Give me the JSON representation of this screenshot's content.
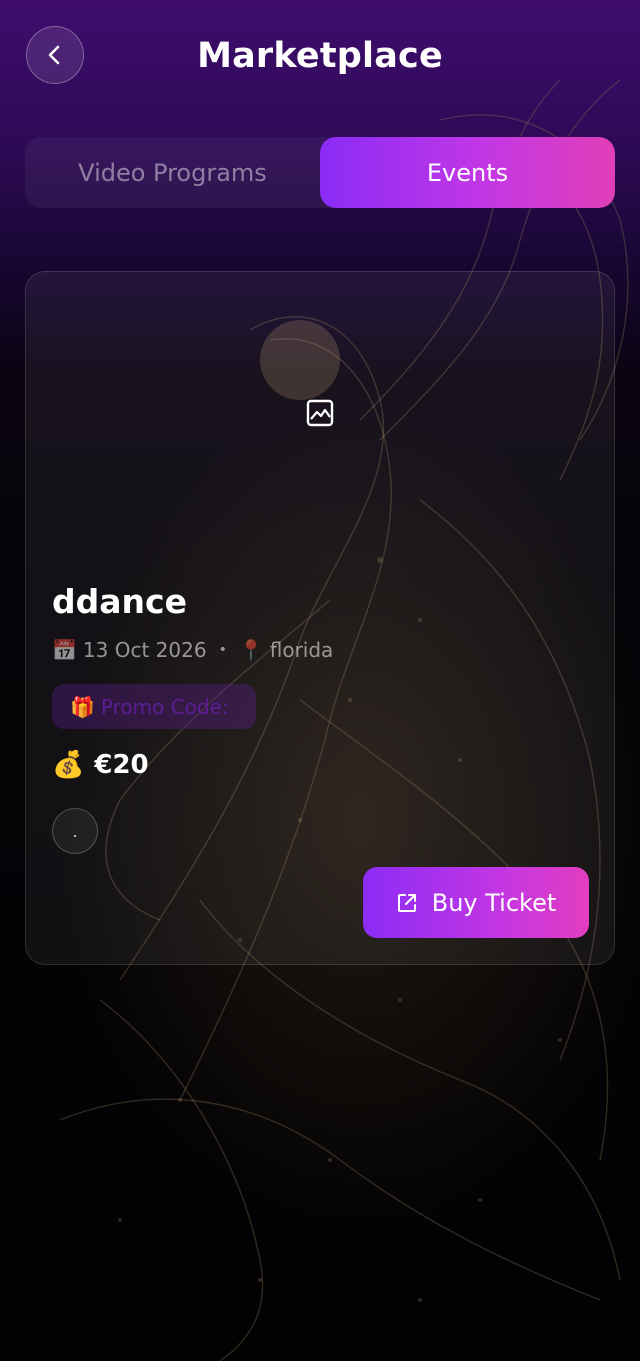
{
  "header": {
    "title": "Marketplace",
    "back_icon": "chevron-left-icon"
  },
  "tabs": [
    {
      "label": "Video Programs",
      "active": false
    },
    {
      "label": "Events",
      "active": true
    }
  ],
  "event": {
    "image_icon": "image-placeholder-icon",
    "title": "ddance",
    "date_icon": "📅",
    "date": "13 Oct 2026",
    "separator": "•",
    "location_icon": "📍",
    "location": "florida",
    "promo_icon": "🎁",
    "promo_label": "Promo Code:",
    "price_icon": "💰",
    "price": "€20",
    "extra_badge": ".",
    "buy_label": "Buy Ticket",
    "buy_icon": "external-link-icon"
  },
  "colors": {
    "accent_start": "#8a2cf6",
    "accent_end": "#e13fb8",
    "header_purple": "#3f0c6e",
    "promo_text": "#5d1e95"
  }
}
